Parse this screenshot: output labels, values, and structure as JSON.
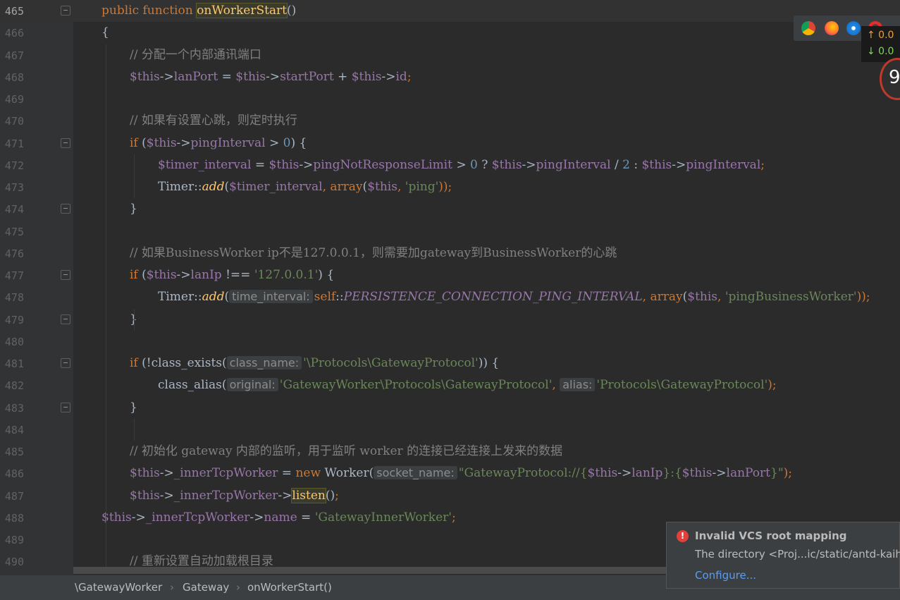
{
  "editor": {
    "current_line": 465,
    "lines": [
      {
        "n": "465",
        "fold": true,
        "indent": 144,
        "tokens": [
          {
            "t": "public function ",
            "c": "kw"
          },
          {
            "t": "onWorkerStart",
            "c": "hl"
          },
          {
            "t": "()",
            "c": "plain"
          }
        ]
      },
      {
        "n": "466",
        "indent": 144,
        "tokens": [
          {
            "t": "{",
            "c": "plain"
          }
        ]
      },
      {
        "n": "467",
        "indent": 184,
        "tokens": [
          {
            "t": "// 分配一个内部通讯端口",
            "c": "cmt"
          }
        ]
      },
      {
        "n": "468",
        "indent": 184,
        "tokens": [
          {
            "t": "$this",
            "c": "var"
          },
          {
            "t": "->",
            "c": "plain"
          },
          {
            "t": "lanPort",
            "c": "var"
          },
          {
            "t": " = ",
            "c": "plain"
          },
          {
            "t": "$this",
            "c": "var"
          },
          {
            "t": "->",
            "c": "plain"
          },
          {
            "t": "startPort",
            "c": "var"
          },
          {
            "t": " + ",
            "c": "plain"
          },
          {
            "t": "$this",
            "c": "var"
          },
          {
            "t": "->",
            "c": "plain"
          },
          {
            "t": "id",
            "c": "var"
          },
          {
            "t": ";",
            "c": "kw"
          }
        ]
      },
      {
        "n": "469",
        "indent": 184,
        "tokens": []
      },
      {
        "n": "470",
        "indent": 184,
        "tokens": [
          {
            "t": "// 如果有设置心跳，则定时执行",
            "c": "cmt"
          }
        ]
      },
      {
        "n": "471",
        "fold": true,
        "indent": 184,
        "tokens": [
          {
            "t": "if",
            "c": "kw"
          },
          {
            "t": " (",
            "c": "plain"
          },
          {
            "t": "$this",
            "c": "var"
          },
          {
            "t": "->",
            "c": "plain"
          },
          {
            "t": "pingInterval",
            "c": "var"
          },
          {
            "t": " > ",
            "c": "plain"
          },
          {
            "t": "0",
            "c": "num"
          },
          {
            "t": ") {",
            "c": "plain"
          }
        ]
      },
      {
        "n": "472",
        "indent": 224,
        "tokens": [
          {
            "t": "$timer_interval",
            "c": "var"
          },
          {
            "t": " = ",
            "c": "plain"
          },
          {
            "t": "$this",
            "c": "var"
          },
          {
            "t": "->",
            "c": "plain"
          },
          {
            "t": "pingNotResponseLimit",
            "c": "var"
          },
          {
            "t": " > ",
            "c": "plain"
          },
          {
            "t": "0",
            "c": "num"
          },
          {
            "t": " ? ",
            "c": "plain"
          },
          {
            "t": "$this",
            "c": "var"
          },
          {
            "t": "->",
            "c": "plain"
          },
          {
            "t": "pingInterval",
            "c": "var"
          },
          {
            "t": " / ",
            "c": "plain"
          },
          {
            "t": "2",
            "c": "num"
          },
          {
            "t": " : ",
            "c": "plain"
          },
          {
            "t": "$this",
            "c": "var"
          },
          {
            "t": "->",
            "c": "plain"
          },
          {
            "t": "pingInterval",
            "c": "var"
          },
          {
            "t": ";",
            "c": "kw"
          }
        ]
      },
      {
        "n": "473",
        "indent": 224,
        "tokens": [
          {
            "t": "Timer",
            "c": "plain"
          },
          {
            "t": "::",
            "c": "plain"
          },
          {
            "t": "add",
            "c": "static"
          },
          {
            "t": "(",
            "c": "plain"
          },
          {
            "t": "$timer_interval",
            "c": "var"
          },
          {
            "t": ", ",
            "c": "kw"
          },
          {
            "t": "array",
            "c": "kw"
          },
          {
            "t": "(",
            "c": "plain"
          },
          {
            "t": "$this",
            "c": "var"
          },
          {
            "t": ", ",
            "c": "kw"
          },
          {
            "t": "'ping'",
            "c": "str"
          },
          {
            "t": "));",
            "c": "kw"
          }
        ]
      },
      {
        "n": "474",
        "fold": true,
        "indent": 184,
        "tokens": [
          {
            "t": "}",
            "c": "plain"
          }
        ]
      },
      {
        "n": "475",
        "indent": 184,
        "tokens": []
      },
      {
        "n": "476",
        "indent": 184,
        "tokens": [
          {
            "t": "// 如果BusinessWorker ip不是127.0.0.1，则需要加gateway到BusinessWorker的心跳",
            "c": "cmt"
          }
        ]
      },
      {
        "n": "477",
        "fold": true,
        "indent": 184,
        "tokens": [
          {
            "t": "if",
            "c": "kw"
          },
          {
            "t": " (",
            "c": "plain"
          },
          {
            "t": "$this",
            "c": "var"
          },
          {
            "t": "->",
            "c": "plain"
          },
          {
            "t": "lanIp",
            "c": "var"
          },
          {
            "t": " !== ",
            "c": "plain"
          },
          {
            "t": "'127.0.0.1'",
            "c": "str"
          },
          {
            "t": ") {",
            "c": "plain"
          }
        ]
      },
      {
        "n": "478",
        "indent": 224,
        "tokens": [
          {
            "t": "Timer",
            "c": "plain"
          },
          {
            "t": "::",
            "c": "plain"
          },
          {
            "t": "add",
            "c": "static"
          },
          {
            "t": "(",
            "c": "plain"
          },
          {
            "t": "time_interval:",
            "c": "hint"
          },
          {
            "t": "self",
            "c": "kw"
          },
          {
            "t": "::",
            "c": "plain"
          },
          {
            "t": "PERSISTENCE_CONNECTION_PING_INTERVAL",
            "c": "const"
          },
          {
            "t": ", ",
            "c": "kw"
          },
          {
            "t": "array",
            "c": "kw"
          },
          {
            "t": "(",
            "c": "plain"
          },
          {
            "t": "$this",
            "c": "var"
          },
          {
            "t": ", ",
            "c": "kw"
          },
          {
            "t": "'pingBusinessWorker'",
            "c": "str"
          },
          {
            "t": "));",
            "c": "kw"
          }
        ]
      },
      {
        "n": "479",
        "fold": true,
        "indent": 184,
        "tokens": [
          {
            "t": "}",
            "c": "plain"
          }
        ]
      },
      {
        "n": "480",
        "indent": 184,
        "tokens": []
      },
      {
        "n": "481",
        "fold": true,
        "indent": 184,
        "tokens": [
          {
            "t": "if",
            "c": "kw"
          },
          {
            "t": " (!",
            "c": "plain"
          },
          {
            "t": "class_exists",
            "c": "plain"
          },
          {
            "t": "(",
            "c": "plain"
          },
          {
            "t": "class_name:",
            "c": "hint"
          },
          {
            "t": "'\\Protocols\\GatewayProtocol'",
            "c": "str"
          },
          {
            "t": ")) {",
            "c": "plain"
          }
        ]
      },
      {
        "n": "482",
        "indent": 224,
        "tokens": [
          {
            "t": "class_alias",
            "c": "plain"
          },
          {
            "t": "(",
            "c": "plain"
          },
          {
            "t": "original:",
            "c": "hint"
          },
          {
            "t": "'GatewayWorker\\Protocols\\GatewayProtocol'",
            "c": "str"
          },
          {
            "t": ", ",
            "c": "kw"
          },
          {
            "t": "alias:",
            "c": "hint"
          },
          {
            "t": "'Protocols\\GatewayProtocol'",
            "c": "str"
          },
          {
            "t": ");",
            "c": "kw"
          }
        ]
      },
      {
        "n": "483",
        "fold": true,
        "indent": 184,
        "tokens": [
          {
            "t": "}",
            "c": "plain"
          }
        ]
      },
      {
        "n": "484",
        "indent": 184,
        "tokens": []
      },
      {
        "n": "485",
        "indent": 184,
        "tokens": [
          {
            "t": "// 初始化 gateway 内部的监听，用于监听 worker 的连接已经连接上发来的数据",
            "c": "cmt"
          }
        ]
      },
      {
        "n": "486",
        "indent": 184,
        "tokens": [
          {
            "t": "$this",
            "c": "var"
          },
          {
            "t": "->",
            "c": "plain"
          },
          {
            "t": "_innerTcpWorker",
            "c": "var"
          },
          {
            "t": " = ",
            "c": "plain"
          },
          {
            "t": "new ",
            "c": "kw"
          },
          {
            "t": "Worker",
            "c": "plain"
          },
          {
            "t": "(",
            "c": "plain"
          },
          {
            "t": "socket_name:",
            "c": "hint"
          },
          {
            "t": "\"GatewayProtocol://{",
            "c": "str"
          },
          {
            "t": "$this",
            "c": "var"
          },
          {
            "t": "->",
            "c": "plain"
          },
          {
            "t": "lanIp",
            "c": "var"
          },
          {
            "t": "}:{",
            "c": "str"
          },
          {
            "t": "$this",
            "c": "var"
          },
          {
            "t": "->",
            "c": "plain"
          },
          {
            "t": "lanPort",
            "c": "var"
          },
          {
            "t": "}\"",
            "c": "str"
          },
          {
            "t": ");",
            "c": "kw"
          }
        ]
      },
      {
        "n": "487",
        "indent": 184,
        "tokens": [
          {
            "t": "$this",
            "c": "var"
          },
          {
            "t": "->",
            "c": "plain"
          },
          {
            "t": "_innerTcpWorker",
            "c": "var"
          },
          {
            "t": "->",
            "c": "plain"
          },
          {
            "t": "listen",
            "c": "hl"
          },
          {
            "t": "()",
            "c": "plain"
          },
          {
            "t": ";",
            "c": "kw"
          }
        ]
      },
      {
        "n": "488",
        "indent": 144,
        "tokens": [
          {
            "t": "$this",
            "c": "var"
          },
          {
            "t": "->",
            "c": "plain"
          },
          {
            "t": "_innerTcpWorker",
            "c": "var"
          },
          {
            "t": "->",
            "c": "plain"
          },
          {
            "t": "name",
            "c": "var"
          },
          {
            "t": " = ",
            "c": "plain"
          },
          {
            "t": "'GatewayInnerWorker'",
            "c": "str"
          },
          {
            "t": ";",
            "c": "kw"
          }
        ]
      },
      {
        "n": "489",
        "indent": 184,
        "tokens": []
      },
      {
        "n": "490",
        "indent": 184,
        "tokens": [
          {
            "t": "// 重新设置自动加载根目录",
            "c": "cmt"
          }
        ]
      }
    ]
  },
  "breadcrumb": [
    "\\GatewayWorker",
    "Gateway",
    "onWorkerStart()"
  ],
  "browser_icons": [
    "chrome-icon",
    "firefox-icon",
    "safari-icon",
    "opera-icon"
  ],
  "network": {
    "up": "↑ 0.0",
    "down": "↓ 0.0"
  },
  "perf_value": "9",
  "notification": {
    "title": "Invalid VCS root mapping",
    "body": "The directory <Proj...ic/static/antd-kaihe",
    "link": "Configure..."
  }
}
